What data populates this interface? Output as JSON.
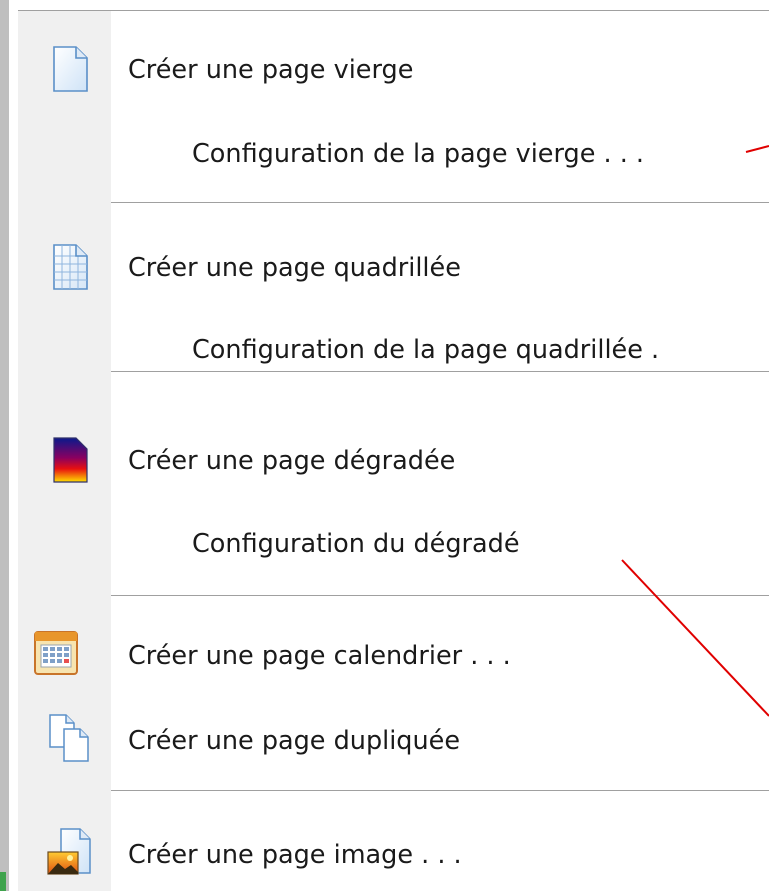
{
  "menu": {
    "items": [
      {
        "label": "Créer une page vierge",
        "icon": "blank-page-icon"
      },
      {
        "label": "Configuration de la page vierge . . ."
      },
      {
        "label": "Créer une page quadrillée",
        "icon": "grid-page-icon"
      },
      {
        "label": "Configuration de la page quadrillée ."
      },
      {
        "label": "Créer une page dégradée",
        "icon": "gradient-page-icon"
      },
      {
        "label": "Configuration du dégradé"
      },
      {
        "label": "Créer une page calendrier . . .",
        "icon": "calendar-icon"
      },
      {
        "label": "Créer une page dupliquée",
        "icon": "duplicate-page-icon"
      },
      {
        "label": "Créer une page image . . .",
        "icon": "image-page-icon"
      }
    ]
  },
  "colors": {
    "annotation_line": "#e00000",
    "separator": "#a0a0a0",
    "gutter": "#f0f0f0"
  }
}
